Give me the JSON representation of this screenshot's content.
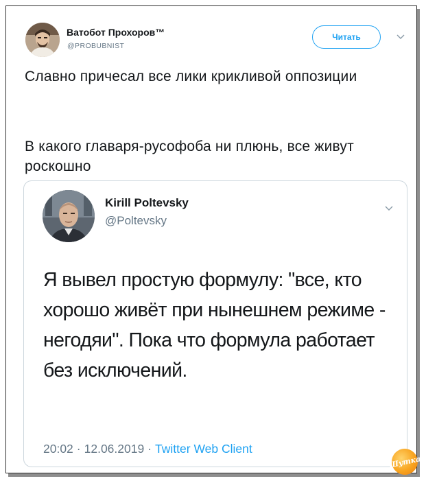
{
  "tweet": {
    "author_name": "Ватобот Прохоров™",
    "author_handle": "@PROBUBNIST",
    "follow_label": "Читать",
    "text_paragraphs": [
      "Славно причесал все лики крикливой оппозиции",
      "В какого главаря-русофоба ни плюнь, все живут роскошно"
    ]
  },
  "quoted_tweet": {
    "author_name": "Kirill Poltevsky",
    "author_handle": "@Poltevsky",
    "text": "Я вывел простую формулу: \"все, кто хорошо живёт при нынешнем режиме - негодяи\". Пока что формула работает без исключений.",
    "time": "20:02",
    "date": "12.06.2019",
    "client": "Twitter Web Client",
    "separator": "·"
  },
  "watermark": {
    "text": "Шутка"
  },
  "colors": {
    "accent": "#1da1f2",
    "text": "#14171a",
    "muted": "#657786",
    "border": "#ccd6dd"
  },
  "icons": [
    "chevron-down-icon",
    "avatar-photo",
    "logo-badge"
  ]
}
